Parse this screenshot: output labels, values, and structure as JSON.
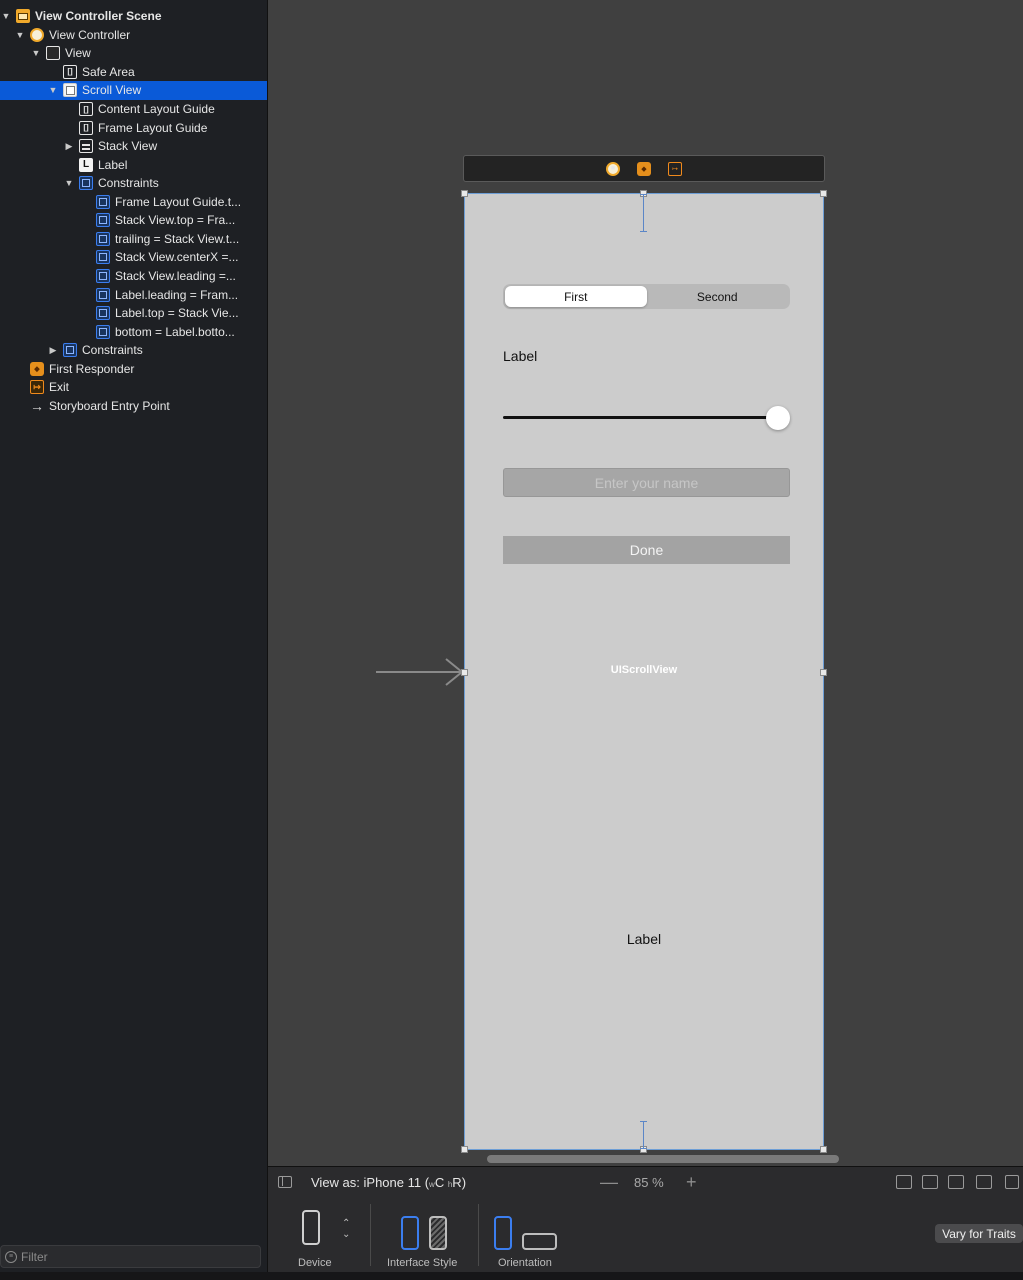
{
  "outline": {
    "rows": [
      {
        "label": "View Controller Scene",
        "disclosure": "▼",
        "icon": "scene-icon"
      },
      {
        "label": "View Controller",
        "disclosure": "▼",
        "icon": "view-controller-icon"
      },
      {
        "label": "View",
        "disclosure": "▼",
        "icon": "view-icon"
      },
      {
        "label": "Safe Area",
        "disclosure": "",
        "icon": "layout-guide-icon"
      },
      {
        "label": "Scroll View",
        "disclosure": "▼",
        "icon": "scroll-view-icon"
      },
      {
        "label": "Content Layout Guide",
        "disclosure": "",
        "icon": "layout-guide-icon"
      },
      {
        "label": "Frame Layout Guide",
        "disclosure": "",
        "icon": "layout-guide-icon"
      },
      {
        "label": "Stack View",
        "disclosure": "▶",
        "icon": "stack-view-icon"
      },
      {
        "label": "Label",
        "disclosure": "",
        "icon": "label-icon"
      },
      {
        "label": "Constraints",
        "disclosure": "▼",
        "icon": "constraints-icon"
      },
      {
        "label": "Frame Layout Guide.t...",
        "disclosure": "",
        "icon": "constraint-icon"
      },
      {
        "label": "Stack View.top = Fra...",
        "disclosure": "",
        "icon": "constraint-icon"
      },
      {
        "label": "trailing = Stack View.t...",
        "disclosure": "",
        "icon": "constraint-icon"
      },
      {
        "label": "Stack View.centerX =...",
        "disclosure": "",
        "icon": "constraint-icon"
      },
      {
        "label": "Stack View.leading =...",
        "disclosure": "",
        "icon": "constraint-icon"
      },
      {
        "label": "Label.leading = Fram...",
        "disclosure": "",
        "icon": "constraint-icon"
      },
      {
        "label": "Label.top = Stack Vie...",
        "disclosure": "",
        "icon": "constraint-icon"
      },
      {
        "label": "bottom = Label.botto...",
        "disclosure": "",
        "icon": "constraint-icon"
      },
      {
        "label": "Constraints",
        "disclosure": "▶",
        "icon": "constraints-icon"
      },
      {
        "label": "First Responder",
        "disclosure": "",
        "icon": "first-responder-icon"
      },
      {
        "label": "Exit",
        "disclosure": "",
        "icon": "exit-icon"
      },
      {
        "label": "Storyboard Entry Point",
        "disclosure": "",
        "icon": "arrow-right-icon"
      }
    ],
    "selected_index": 4,
    "filter_placeholder": "Filter"
  },
  "canvas": {
    "segmented": {
      "segments": [
        "First",
        "Second"
      ],
      "selected": 0
    },
    "top_label": "Label",
    "slider_value": 1.0,
    "name_placeholder": "Enter your name",
    "done_label": "Done",
    "scroll_view_class": "UIScrollView",
    "bottom_label": "Label"
  },
  "toolbar": {
    "view_as_prefix": "View as: iPhone 11 (",
    "size_w": "w",
    "size_w_val": "C",
    "size_h": "h",
    "size_h_val": "R",
    "view_as_suffix": ")",
    "zoom_minus": "—",
    "zoom": "85 %",
    "zoom_plus": "+"
  },
  "config": {
    "device_label": "Device",
    "interface_style_label": "Interface Style",
    "orientation_label": "Orientation",
    "vary_traits_label": "Vary for Traits"
  },
  "colors": {
    "selection": "#0a5ad8",
    "canvas": "#404040",
    "device": "#cccccc",
    "accent_blue": "#3b7ef0"
  }
}
